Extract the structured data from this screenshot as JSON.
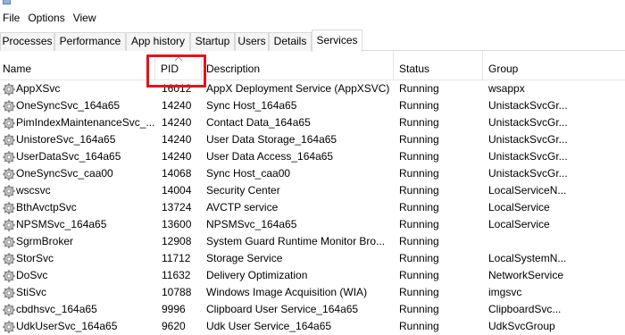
{
  "menu": [
    "File",
    "Options",
    "View"
  ],
  "tabs": [
    "Processes",
    "Performance",
    "App history",
    "Startup",
    "Users",
    "Details",
    "Services"
  ],
  "active_tab": "Services",
  "columns": {
    "name": "Name",
    "pid": "PID",
    "description": "Description",
    "status": "Status",
    "group": "Group"
  },
  "sort": {
    "column": "PID",
    "indicator": "chevron-up-icon"
  },
  "highlight": {
    "target": "PID",
    "color": "#e2141d"
  },
  "services": [
    {
      "name": "AppXSvc",
      "pid": "16012",
      "description": "AppX Deployment Service (AppXSVC)",
      "status": "Running",
      "group": "wsappx"
    },
    {
      "name": "OneSyncSvc_164a65",
      "pid": "14240",
      "description": "Sync Host_164a65",
      "status": "Running",
      "group": "UnistackSvcGr..."
    },
    {
      "name": "PimIndexMaintenanceSvc_...",
      "pid": "14240",
      "description": "Contact Data_164a65",
      "status": "Running",
      "group": "UnistackSvcGr..."
    },
    {
      "name": "UnistoreSvc_164a65",
      "pid": "14240",
      "description": "User Data Storage_164a65",
      "status": "Running",
      "group": "UnistackSvcGr..."
    },
    {
      "name": "UserDataSvc_164a65",
      "pid": "14240",
      "description": "User Data Access_164a65",
      "status": "Running",
      "group": "UnistackSvcGr..."
    },
    {
      "name": "OneSyncSvc_caa00",
      "pid": "14068",
      "description": "Sync Host_caa00",
      "status": "Running",
      "group": "UnistackSvcGr..."
    },
    {
      "name": "wscsvc",
      "pid": "14004",
      "description": "Security Center",
      "status": "Running",
      "group": "LocalServiceN..."
    },
    {
      "name": "BthAvctpSvc",
      "pid": "13724",
      "description": "AVCTP service",
      "status": "Running",
      "group": "LocalService"
    },
    {
      "name": "NPSMSvc_164a65",
      "pid": "13600",
      "description": "NPSMSvc_164a65",
      "status": "Running",
      "group": "LocalService"
    },
    {
      "name": "SgrmBroker",
      "pid": "12908",
      "description": "System Guard Runtime Monitor Bro...",
      "status": "Running",
      "group": ""
    },
    {
      "name": "StorSvc",
      "pid": "11712",
      "description": "Storage Service",
      "status": "Running",
      "group": "LocalSystemN..."
    },
    {
      "name": "DoSvc",
      "pid": "11632",
      "description": "Delivery Optimization",
      "status": "Running",
      "group": "NetworkService"
    },
    {
      "name": "StiSvc",
      "pid": "10788",
      "description": "Windows Image Acquisition (WIA)",
      "status": "Running",
      "group": "imgsvc"
    },
    {
      "name": "cbdhsvc_164a65",
      "pid": "9996",
      "description": "Clipboard User Service_164a65",
      "status": "Running",
      "group": "ClipboardSvc..."
    },
    {
      "name": "UdkUserSvc_164a65",
      "pid": "9620",
      "description": "Udk User Service_164a65",
      "status": "Running",
      "group": "UdkSvcGroup"
    }
  ]
}
